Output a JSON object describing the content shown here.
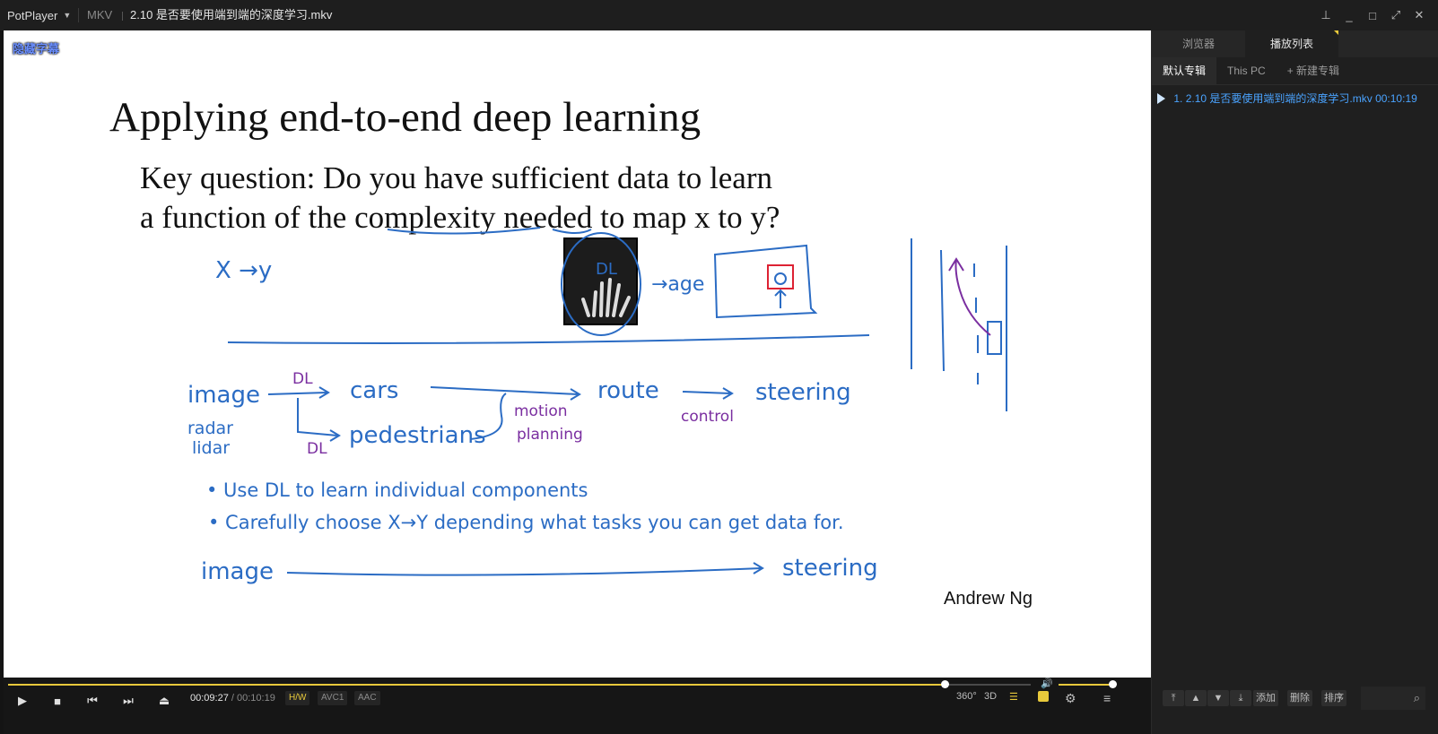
{
  "titlebar": {
    "app_name": "PotPlayer",
    "format": "MKV",
    "file_title": "2.10 是否要使用端到端的深度学习.mkv"
  },
  "video": {
    "subtitle_toggle": "隐藏字幕",
    "slide": {
      "title": "Applying end-to-end deep learning",
      "question_line1": "Key question: Do you have sufficient data to learn",
      "question_line2": "a function of the complexity needed to map x to y?",
      "author": "Andrew Ng"
    },
    "handwriting": {
      "x_to_y": "X →y",
      "age": "→age",
      "xray_dl": "DL",
      "image": "image",
      "radar": "radar",
      "lidar": "lidar",
      "dl_top": "DL",
      "dl_bottom": "DL",
      "cars": "cars",
      "pedestrians": "pedestrians",
      "motion": "motion",
      "planning": "planning",
      "route": "route",
      "control": "control",
      "steering": "steering",
      "bullet1": "• Use  DL  to  learn  individual  components",
      "bullet2": "• Carefully  choose  X→Y  depending  what  tasks  you  can  get  data  for.",
      "image2": "image",
      "steering2": "steering"
    }
  },
  "controls": {
    "current_time": "00:09:27",
    "separator": "/",
    "duration": "00:10:19",
    "progress": 0.916,
    "volume": 1.0,
    "badges": {
      "hw": "H/W",
      "video_codec": "AVC1",
      "audio_codec": "AAC"
    },
    "right_labels": {
      "vr": "360°",
      "three_d": "3D"
    }
  },
  "panel": {
    "tabs": [
      "浏览器",
      "播放列表"
    ],
    "subtabs": [
      "默认专辑",
      "This PC",
      "+ 新建专辑"
    ],
    "playlist": [
      {
        "index": "1.",
        "title": "2.10 是否要使用端到端的深度学习.mkv",
        "duration": "00:10:19"
      }
    ],
    "buttons": {
      "add": "添加",
      "delete": "删除",
      "sort": "排序"
    }
  },
  "colors": {
    "accent": "#e8c93b",
    "ink_blue": "#2b6cc4",
    "ink_purple": "#7a2ea0",
    "playlist_text": "#4aa3ff"
  }
}
